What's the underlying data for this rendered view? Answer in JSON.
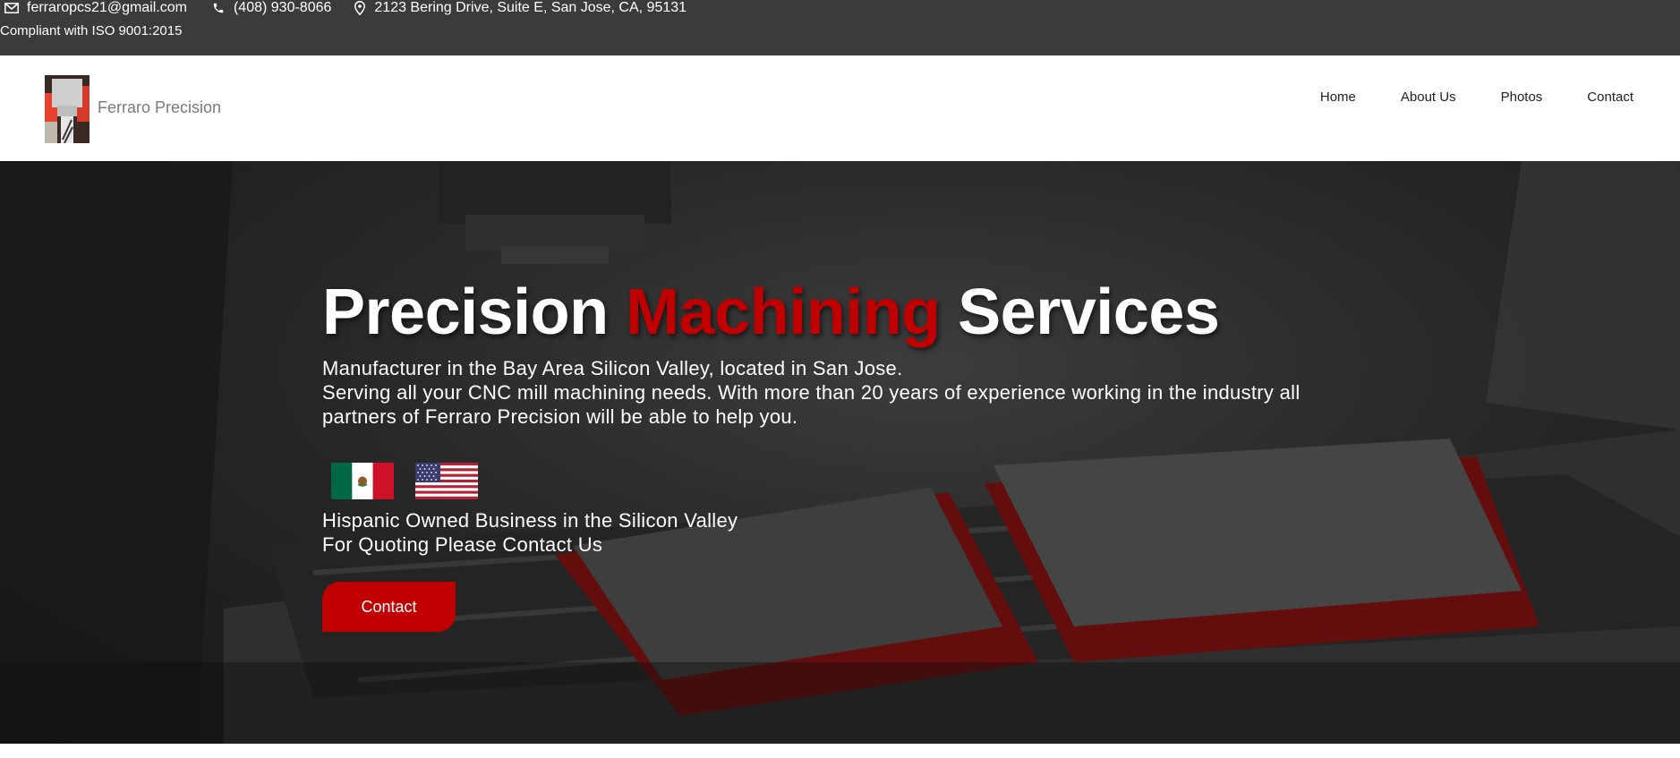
{
  "topbar": {
    "email": "ferraropcs21@gmail.com",
    "phone": "(408) 930-8066",
    "address": "2123 Bering Drive, Suite E, San Jose, CA, 95131",
    "compliance": "Compliant with ISO 9001:2015"
  },
  "header": {
    "brand": "Ferraro Precision",
    "nav": [
      "Home",
      "About Us",
      "Photos",
      "Contact"
    ]
  },
  "hero": {
    "title_part1": "Precision ",
    "title_accent": "Machining",
    "title_part2": " Services",
    "desc_line1": "Manufacturer in the Bay Area Silicon Valley, located in San Jose.",
    "desc_line2": "Serving all your CNC mill machining needs. With more than 20 years of experience working in the industry all partners of Ferraro Precision will be able to help you.",
    "owned_line1": "Hispanic Owned Business in the Silicon Valley",
    "owned_line2": "For Quoting Please Contact Us",
    "button_label": "Contact"
  },
  "colors": {
    "topbar_bg": "#3b3b3c",
    "accent_red": "#c00000",
    "white": "#ffffff"
  },
  "icons": [
    "mail-icon",
    "phone-icon",
    "location-pin-icon",
    "mexico-flag-icon",
    "usa-flag-icon"
  ]
}
